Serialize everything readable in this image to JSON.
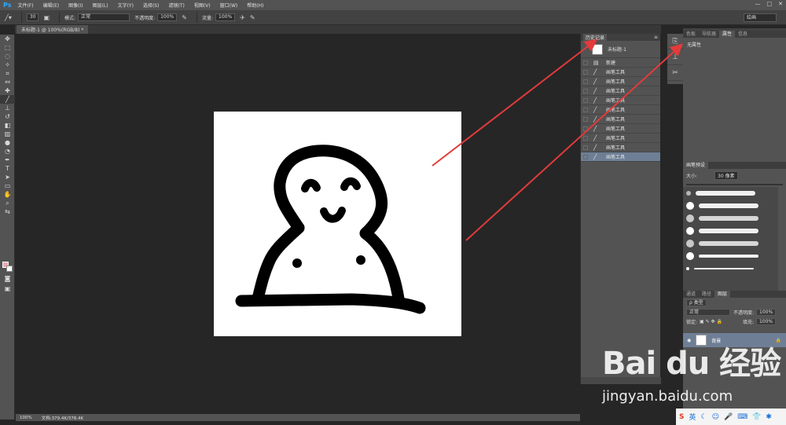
{
  "app": {
    "logo": "Ps",
    "menus": [
      "文件(F)",
      "编辑(E)",
      "图像(I)",
      "图层(L)",
      "文字(Y)",
      "选择(S)",
      "滤镜(T)",
      "视图(V)",
      "窗口(W)",
      "帮助(H)"
    ],
    "window_buttons": [
      "—",
      "□",
      "✕"
    ]
  },
  "options": {
    "brush_size": "30",
    "mode_label": "模式:",
    "mode_value": "正常",
    "opacity_label": "不透明度:",
    "opacity_value": "100%",
    "flow_label": "流量:",
    "flow_value": "100%",
    "workspace": "绘画"
  },
  "document": {
    "tab_label": "未标题-1 @ 100%(RGB/8) *"
  },
  "statusbar": {
    "zoom": "100%",
    "doc_info": "文档:379.4K/378.4K"
  },
  "history": {
    "title": "历史记录",
    "snapshot_label": "未标题-1",
    "items": [
      {
        "label": "新建",
        "icon": "▤"
      },
      {
        "label": "画笔工具",
        "icon": "╱"
      },
      {
        "label": "画笔工具",
        "icon": "╱"
      },
      {
        "label": "画笔工具",
        "icon": "╱"
      },
      {
        "label": "画笔工具",
        "icon": "╱"
      },
      {
        "label": "画笔工具",
        "icon": "╱"
      },
      {
        "label": "画笔工具",
        "icon": "╱"
      },
      {
        "label": "画笔工具",
        "icon": "╱"
      },
      {
        "label": "画笔工具",
        "icon": "╱"
      },
      {
        "label": "画笔工具",
        "icon": "╱"
      },
      {
        "label": "画笔工具",
        "icon": "╱"
      }
    ]
  },
  "right_panels": {
    "props_tabs": [
      "色板",
      "导航器",
      "属性",
      "信息"
    ],
    "props_text": "无属性",
    "brush_tab": "画笔预设",
    "brush_size_label": "大小:",
    "brush_size_value": "30 像素",
    "layers_tabs": [
      "通道",
      "路径",
      "图层"
    ],
    "kind_label": "ρ 类型",
    "blend_mode": "正常",
    "layer_opacity_label": "不透明度:",
    "layer_opacity_value": "100%",
    "lock_label": "锁定:",
    "fill_label": "填充:",
    "fill_value": "100%",
    "layer_name": "背景"
  },
  "watermark": {
    "text": "Bai du 经验",
    "url": "jingyan.baidu.com"
  },
  "colors": {
    "accent_arrow": "#e23b3b",
    "foreground": "#f3a7b0",
    "selection": "#6e7f95"
  }
}
